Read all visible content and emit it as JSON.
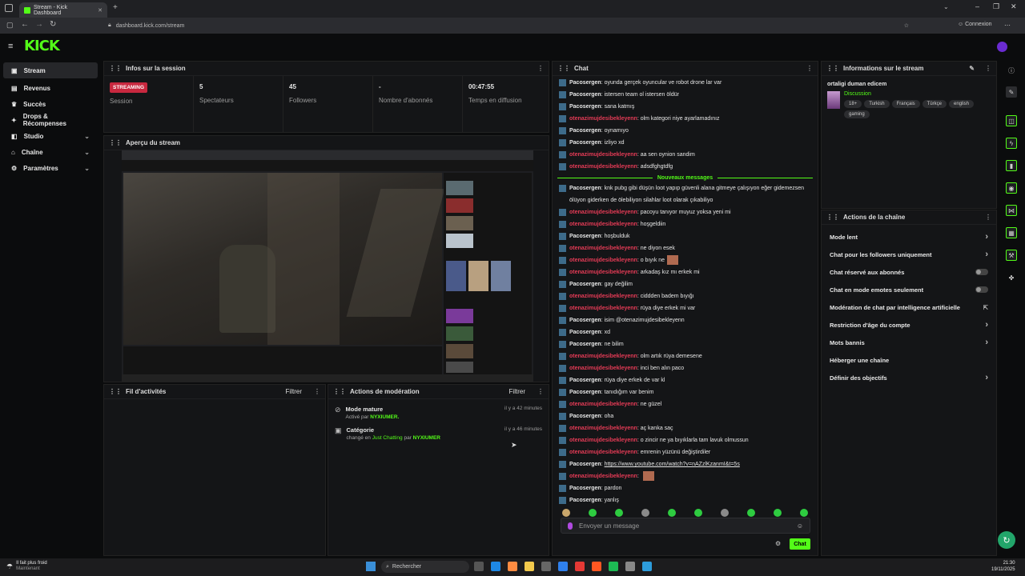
{
  "browser": {
    "tab_title": "Stream - Kick Dashboard",
    "url": "dashboard.kick.com/stream",
    "profile_label": "Connexion"
  },
  "brand": {
    "logo": "KICK",
    "accent": "#53fc18"
  },
  "sidebar": {
    "items": [
      {
        "label": "Stream",
        "icon": "broadcast-icon"
      },
      {
        "label": "Revenus",
        "icon": "wallet-icon"
      },
      {
        "label": "Succès",
        "icon": "trophy-icon"
      },
      {
        "label": "Drops & Récompenses",
        "icon": "gift-icon"
      },
      {
        "label": "Studio",
        "icon": "studio-icon"
      },
      {
        "label": "Chaîne",
        "icon": "channel-icon"
      },
      {
        "label": "Paramètres",
        "icon": "gear-icon"
      }
    ]
  },
  "session": {
    "title": "Infos sur la session",
    "status_badge": "STREAMING",
    "status_label": "Session",
    "stats": [
      {
        "value": "5",
        "label": "Spectateurs"
      },
      {
        "value": "45",
        "label": "Followers"
      },
      {
        "value": "-",
        "label": "Nombre d'abonnés"
      },
      {
        "value": "00:47:55",
        "label": "Temps en diffusion"
      }
    ]
  },
  "preview": {
    "title": "Aperçu du stream"
  },
  "activity": {
    "title": "Fil d'activités",
    "filter": "Filtrer"
  },
  "moderation": {
    "title": "Actions de modération",
    "filter": "Filtrer",
    "items": [
      {
        "title": "Mode mature",
        "sub_prefix": "Activé par",
        "sub_user": "NYXIUMER.",
        "sub_mid": "",
        "sub_cat": "",
        "time": "il y a 42 minutes"
      },
      {
        "title": "Catégorie",
        "sub_prefix": "changé en",
        "sub_cat": "Just Chatting",
        "sub_mid": "par",
        "sub_user": "NYXIUMER",
        "time": "il y a 46 minutes"
      }
    ]
  },
  "chat": {
    "title": "Chat",
    "new_messages": "Nouveaux messages",
    "messages_before": [
      {
        "user": "Pacosergen",
        "type": "u1",
        "text": "oyunda gerçek oyuncular ve robot drone lar var"
      },
      {
        "user": "Pacosergen",
        "type": "u1",
        "text": "istersen team ol istersen öldür"
      },
      {
        "user": "Pacosergen",
        "type": "u1",
        "text": "sana katmış"
      },
      {
        "user": "otenazimujdesibekleyenn",
        "type": "u2",
        "text": "olm kategori niye ayarlamadınız"
      },
      {
        "user": "Pacosergen",
        "type": "u1",
        "text": "oynamıyo"
      },
      {
        "user": "Pacosergen",
        "type": "u1",
        "text": "izliyo xd"
      },
      {
        "user": "otenazimujdesibekleyenn",
        "type": "u2",
        "text": "aa sen oynion sandim"
      },
      {
        "user": "otenazimujdesibekleyenn",
        "type": "u2",
        "text": "adsdfghgtdfg"
      }
    ],
    "messages_after": [
      {
        "user": "Pacosergen",
        "type": "u1",
        "text": "knk pubg gibi düşün loot yapıp güvenli alana gitmeye çalışıyon eğer gidemezsen ölüyon giderken de ölebiliyon silahlar loot olarak çıkabiliyo"
      },
      {
        "user": "otenazimujdesibekleyenn",
        "type": "u2",
        "text": "pacoyu tanıyor muyuz yoksa yeni mi"
      },
      {
        "user": "otenazimujdesibekleyenn",
        "type": "u2",
        "text": "hoşgeldiin"
      },
      {
        "user": "Pacosergen",
        "type": "u1",
        "text": "hoşbulduk"
      },
      {
        "user": "otenazimujdesibekleyenn",
        "type": "u2",
        "text": "ne diyon esek"
      },
      {
        "user": "otenazimujdesibekleyenn",
        "type": "u2",
        "text": "o bıyık ne"
      },
      {
        "user": "otenazimujdesibekleyenn",
        "type": "u2",
        "text": "arkadaş kız mı erkek mi"
      },
      {
        "user": "Pacosergen",
        "type": "u1",
        "text": "gay değilim"
      },
      {
        "user": "otenazimujdesibekleyenn",
        "type": "u2",
        "text": "ciddden badem bıyığı"
      },
      {
        "user": "otenazimujdesibekleyenn",
        "type": "u2",
        "text": "rüya diye erkek mi var"
      },
      {
        "user": "Pacosergen",
        "type": "u1",
        "text": "isim @otenazimujdesibekleyenn"
      },
      {
        "user": "Pacosergen",
        "type": "u1",
        "text": "xd"
      },
      {
        "user": "Pacosergen",
        "type": "u1",
        "text": "ne bilim"
      },
      {
        "user": "otenazimujdesibekleyenn",
        "type": "u2",
        "text": "olm artık rüya demesene"
      },
      {
        "user": "otenazimujdesibekleyenn",
        "type": "u2",
        "text": "inci ben alın paco"
      },
      {
        "user": "Pacosergen",
        "type": "u1",
        "text": "rüya diye erkek de var kl"
      },
      {
        "user": "Pacosergen",
        "type": "u1",
        "text": "tanıdığım var benim"
      },
      {
        "user": "otenazimujdesibekleyenn",
        "type": "u2",
        "text": "ne güzel"
      },
      {
        "user": "Pacosergen",
        "type": "u1",
        "text": "oha"
      },
      {
        "user": "otenazimujdesibekleyenn",
        "type": "u2",
        "text": "aç kanka saç"
      },
      {
        "user": "otenazimujdesibekleyenn",
        "type": "u2",
        "text": "o zincir ne ya bıyıklarla tam lavuk olmussun"
      },
      {
        "user": "otenazimujdesibekleyenn",
        "type": "u2",
        "text": "emrenin yüzünü değiştirdiler"
      },
      {
        "user": "Pacosergen",
        "type": "u1",
        "text": "https://www.youtube.com/watch?v=nAZzlKzanmI&t=5s"
      },
      {
        "user": "otenazimujdesibekleyenn",
        "type": "u2",
        "text": ""
      },
      {
        "user": "Pacosergen",
        "type": "u1",
        "text": "pardon"
      },
      {
        "user": "Pacosergen",
        "type": "u1",
        "text": "yanlış"
      }
    ],
    "input_placeholder": "Envoyer un message",
    "send_label": "Chat"
  },
  "stream_info": {
    "title": "Informations sur le stream",
    "stream_title": "ortaligi duman edicem",
    "category": "Discussion",
    "tags": [
      "18+",
      "Turkish",
      "Français",
      "Türkçe",
      "english",
      "gaming"
    ]
  },
  "channel_actions": {
    "title": "Actions de la chaîne",
    "items": [
      {
        "label": "Mode lent",
        "control": "chevron"
      },
      {
        "label": "Chat pour les followers uniquement",
        "control": "chevron"
      },
      {
        "label": "Chat réservé aux abonnés",
        "control": "toggle"
      },
      {
        "label": "Chat en mode emotes seulement",
        "control": "toggle"
      },
      {
        "label": "Modération de chat par intelligence artificielle",
        "control": "external"
      },
      {
        "label": "Restriction d'âge du compte",
        "control": "chevron"
      },
      {
        "label": "Mots bannis",
        "control": "chevron"
      },
      {
        "label": "Héberger une chaîne",
        "control": "none"
      },
      {
        "label": "Définir des objectifs",
        "control": "chevron"
      }
    ]
  },
  "taskbar": {
    "weather": "Il fait plus froid",
    "weather_sub": "Maintenant",
    "search": "Rechercher",
    "time": "21:30",
    "date": "19/11/2025"
  }
}
